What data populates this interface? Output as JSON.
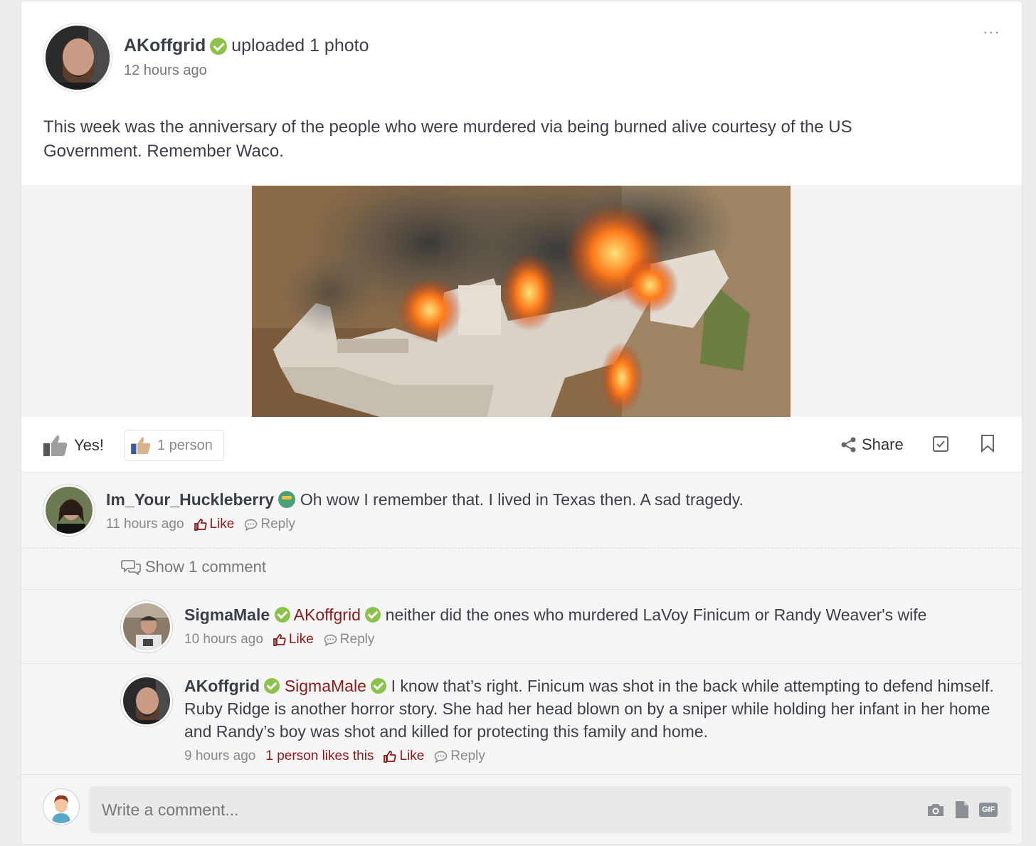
{
  "post": {
    "author": "AKoffgrid",
    "action": "uploaded 1 photo",
    "time": "12 hours ago",
    "more_icon": "···",
    "text": "This week was the anniversary of the people who were murdered via being burned alive courtesy of the US Government. Remember Waco."
  },
  "actions": {
    "yes_label": "Yes!",
    "likes_label": "1 person",
    "share_label": "Share"
  },
  "comments": [
    {
      "author": "Im_Your_Huckleberry",
      "text": "Oh wow I remember that. I lived in Texas then. A sad tragedy.",
      "time": "11 hours ago",
      "like_label": "Like",
      "reply_label": "Reply"
    }
  ],
  "show_more_label": "Show 1 comment",
  "replies": [
    {
      "author": "SigmaMale",
      "mention": "AKoffgrid",
      "text": "neither did the ones who murdered LaVoy Finicum or Randy Weaver's wife",
      "time": "10 hours ago",
      "like_label": "Like",
      "reply_label": "Reply"
    },
    {
      "author": "AKoffgrid",
      "mention": "SigmaMale",
      "text": "I know that’s right. Finicum was shot in the back while attempting to defend himself. Ruby Ridge is another horror story. She had her head blown on by a sniper while holding her infant in her home and Randy’s boy was shot and killed for protecting this family and home.",
      "time": "9 hours ago",
      "likes": "1 person likes this",
      "like_label": "Like",
      "reply_label": "Reply"
    }
  ],
  "composer": {
    "placeholder": "Write a comment...",
    "gif_label": "GIF"
  },
  "colors": {
    "verified": "#8bc34a",
    "mention": "#8b1a1a",
    "background": "#ececec"
  }
}
